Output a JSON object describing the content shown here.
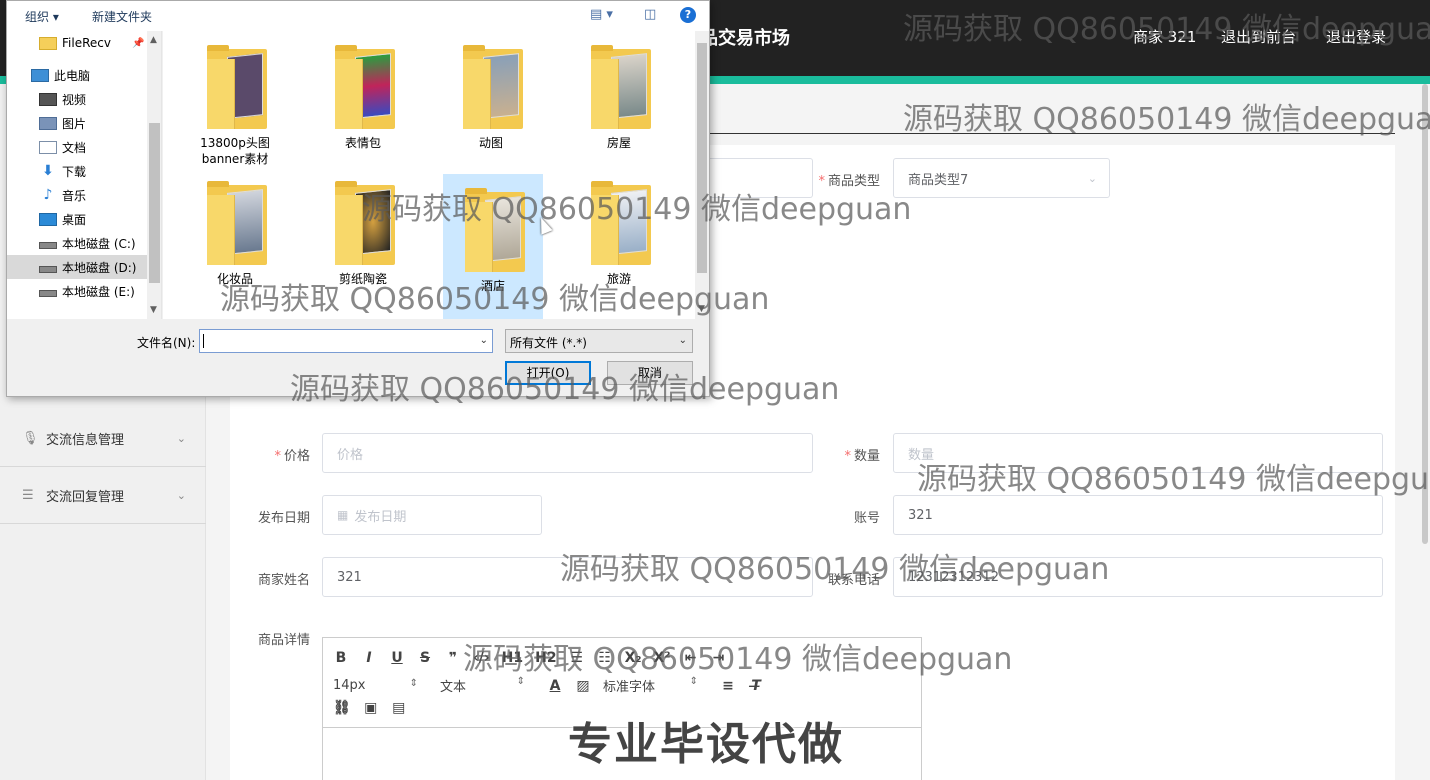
{
  "app": {
    "site_title_partial": "品交易市场",
    "merchant": "商家 321",
    "back_to_front": "退出到前台",
    "logout": "退出登录"
  },
  "sidebar": {
    "items": [
      {
        "label": "交流信息管理",
        "icon": "microphone-icon"
      },
      {
        "label": "交流回复管理",
        "icon": "list-icon"
      }
    ]
  },
  "form": {
    "product_type_label": "商品类型",
    "product_type_value": "商品类型7",
    "price_label": "价格",
    "price_placeholder": "价格",
    "quantity_label": "数量",
    "quantity_placeholder": "数量",
    "publish_date_label": "发布日期",
    "publish_date_placeholder": "发布日期",
    "account_label": "账号",
    "account_value": "321",
    "merchant_name_label": "商家姓名",
    "merchant_name_value": "321",
    "phone_label": "联系电话",
    "phone_value": "12312312312",
    "detail_label": "商品详情"
  },
  "editor": {
    "row1": [
      "B",
      "I",
      "U",
      "S",
      "❞",
      "‹/›",
      "H1",
      "H2",
      "☰",
      "☷",
      "X₂",
      "X²",
      "⇤",
      "⇥"
    ],
    "font_size": "14px",
    "block_type": "文本",
    "font_family": "标准字体"
  },
  "dialog": {
    "toolbar_organize": "组织 ▾",
    "toolbar_new_folder": "新建文件夹",
    "help": "?",
    "nav": [
      {
        "label": "FileRecv",
        "icon": "folder-icon"
      },
      {
        "label": "此电脑",
        "icon": "computer-icon"
      },
      {
        "label": "视频",
        "icon": "video-icon"
      },
      {
        "label": "图片",
        "icon": "picture-icon"
      },
      {
        "label": "文档",
        "icon": "document-icon"
      },
      {
        "label": "下载",
        "icon": "download-icon"
      },
      {
        "label": "音乐",
        "icon": "music-icon"
      },
      {
        "label": "桌面",
        "icon": "desktop-icon"
      },
      {
        "label": "本地磁盘 (C:)",
        "icon": "drive-icon"
      },
      {
        "label": "本地磁盘 (D:)",
        "icon": "drive-icon"
      },
      {
        "label": "本地磁盘 (E:)",
        "icon": "drive-icon"
      }
    ],
    "files": [
      {
        "name": "13800p头图banner素材"
      },
      {
        "name": "表情包"
      },
      {
        "name": "动图"
      },
      {
        "name": "房屋"
      },
      {
        "name": "化妆品"
      },
      {
        "name": "剪纸陶瓷"
      },
      {
        "name": "酒店"
      },
      {
        "name": "旅游"
      }
    ],
    "filename_label": "文件名(N):",
    "filename_value": "",
    "filetype_value": "所有文件 (*.*)",
    "open_button": "打开(O)",
    "cancel_button": "取消"
  },
  "watermarks": {
    "text": "源码获取 QQ86050149 微信deepguan",
    "banner": "专业毕设代做"
  }
}
